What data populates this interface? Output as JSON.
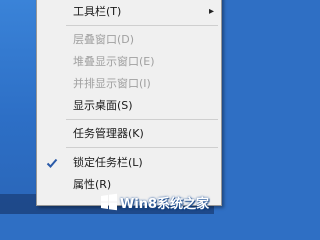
{
  "context_menu": {
    "items": [
      {
        "label": "工具栏(T)",
        "enabled": true,
        "submenu": true,
        "checked": false
      },
      {
        "label": "层叠窗口(D)",
        "enabled": false,
        "submenu": false,
        "checked": false
      },
      {
        "label": "堆叠显示窗口(E)",
        "enabled": false,
        "submenu": false,
        "checked": false
      },
      {
        "label": "并排显示窗口(I)",
        "enabled": false,
        "submenu": false,
        "checked": false
      },
      {
        "label": "显示桌面(S)",
        "enabled": true,
        "submenu": false,
        "checked": false
      },
      {
        "label": "任务管理器(K)",
        "enabled": true,
        "submenu": false,
        "checked": false
      },
      {
        "label": "锁定任务栏(L)",
        "enabled": true,
        "submenu": false,
        "checked": true
      },
      {
        "label": "属性(R)",
        "enabled": true,
        "submenu": false,
        "checked": false
      }
    ],
    "submenu_arrow": "▸"
  },
  "watermark": {
    "text": "Win8系统之家",
    "logo_icon": "windows-logo-icon"
  },
  "colors": {
    "desktop": "#2f6fc4",
    "menu_bg": "#f0f0f0",
    "disabled_text": "#a0a0a0",
    "check": "#2a5aa8"
  }
}
